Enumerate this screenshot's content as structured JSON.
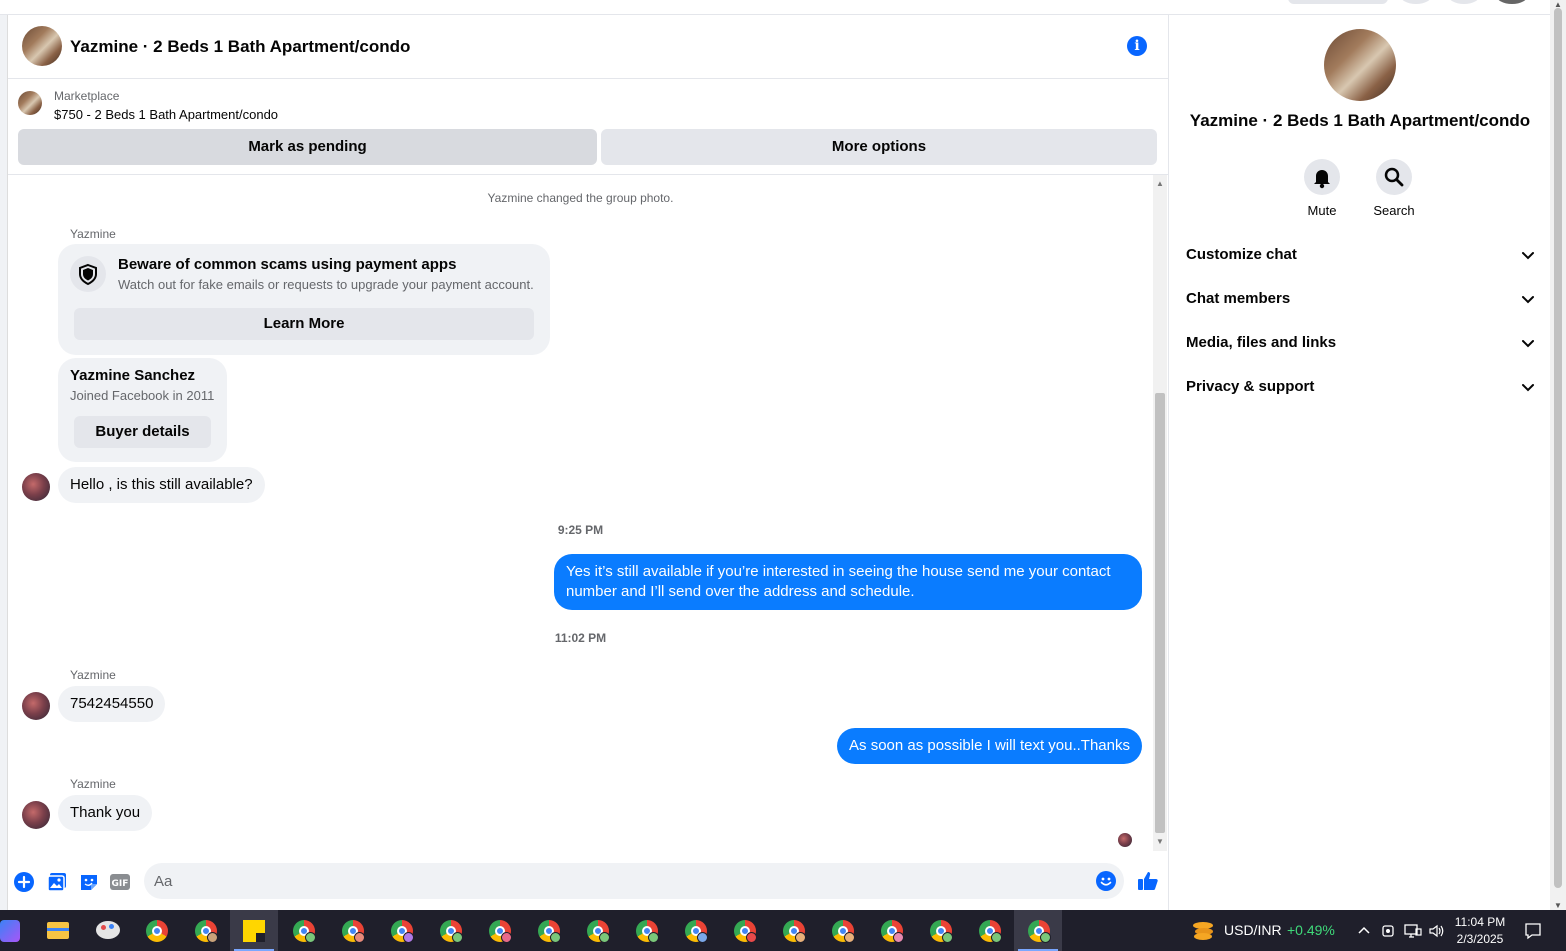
{
  "header": {
    "title": "Yazmine · 2 Beds 1 Bath Apartment/condo",
    "info_icon": "i"
  },
  "marketplace": {
    "label": "Marketplace",
    "listing": "$750 - 2 Beds 1 Bath Apartment/condo",
    "mark_pending": "Mark as pending",
    "more_options": "More options"
  },
  "messages": {
    "system_event": "Yazmine changed the group photo.",
    "sender_1": "Yazmine",
    "scam_card": {
      "title": "Beware of common scams using payment apps",
      "subtitle": "Watch out for fake emails or requests to upgrade your payment account.",
      "button": "Learn More"
    },
    "buyer_card": {
      "name": "Yazmine Sanchez",
      "joined": "Joined Facebook in 2011",
      "button": "Buyer details"
    },
    "msg_1": "Hello , is this still available?",
    "time_1": "9:25 PM",
    "msg_2": "Yes it’s still available if you’re interested in seeing the house send me your contact number and I’ll send over the address and schedule.",
    "time_2": "11:02 PM",
    "sender_2": "Yazmine",
    "msg_3": "7542454550",
    "msg_4": "As soon as possible I will text you..Thanks",
    "sender_3": "Yazmine",
    "msg_5": "Thank you"
  },
  "composer": {
    "placeholder": "Aa"
  },
  "panel": {
    "title": "Yazmine · 2 Beds 1 Bath Apartment/condo",
    "mute": "Mute",
    "search": "Search",
    "sections": [
      "Customize chat",
      "Chat members",
      "Media, files and links",
      "Privacy & support"
    ]
  },
  "taskbar": {
    "currency_pair": "USD/INR",
    "currency_change": "+0.49%",
    "time": "11:04 PM",
    "date": "2/3/2025"
  },
  "colors": {
    "accent": "#0866ff",
    "outgoing_bubble": "#0a7cff",
    "incoming_bubble": "#f0f2f5",
    "positive": "#3fd97a"
  }
}
